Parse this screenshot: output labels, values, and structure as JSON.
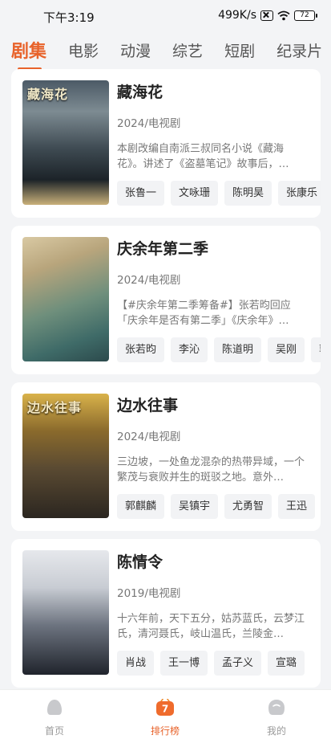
{
  "status_bar": {
    "time": "下午3:19",
    "speed": "499K/s",
    "battery": "72"
  },
  "tabs": [
    {
      "label": "剧集",
      "active": true
    },
    {
      "label": "电影"
    },
    {
      "label": "动漫"
    },
    {
      "label": "综艺"
    },
    {
      "label": "短剧"
    },
    {
      "label": "纪录片"
    }
  ],
  "cards": [
    {
      "title": "藏海花",
      "meta": "2024/电视剧",
      "desc": "本剧改编自南派三叔同名小说《藏海花》。讲述了《盗墓笔记》故事后，…",
      "actors": [
        "张鲁一",
        "文咏珊",
        "陈明昊",
        "张康乐"
      ],
      "poster_text": "藏海花"
    },
    {
      "title": "庆余年第二季",
      "meta": "2024/电视剧",
      "desc": "【#庆余年第二季筹备#】张若昀回应「庆余年是否有第二季」《庆余年》…",
      "actors": [
        "张若昀",
        "李沁",
        "陈道明",
        "吴刚",
        "郭麒麟"
      ],
      "poster_text": ""
    },
    {
      "title": "边水往事",
      "meta": "2024/电视剧",
      "desc": "三边坡，一处鱼龙混杂的热带异域，一个繁茂与衰败并生的斑驳之地。意外…",
      "actors": [
        "郭麒麟",
        "吴镇宇",
        "尤勇智",
        "王迅"
      ],
      "poster_text": "边水往事"
    },
    {
      "title": "陈情令",
      "meta": "2019/电视剧",
      "desc": "十六年前，天下五分，姑苏蓝氏，云梦江氏，清河聂氏，岐山温氏，兰陵金…",
      "actors": [
        "肖战",
        "王一博",
        "孟子义",
        "宣璐"
      ],
      "poster_text": ""
    }
  ],
  "bottom_nav": [
    {
      "label": "首页"
    },
    {
      "label": "排行榜",
      "active": true,
      "badge": "7"
    },
    {
      "label": "我的"
    }
  ],
  "colors": {
    "accent": "#e8632b",
    "background": "#f3f4f6"
  }
}
